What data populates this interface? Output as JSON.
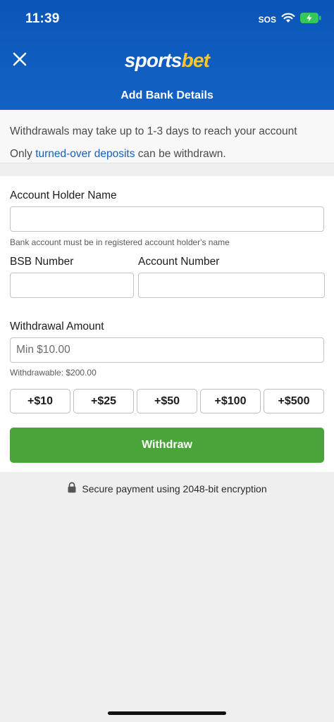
{
  "status_bar": {
    "time": "11:39",
    "sos": "SOS",
    "icons": [
      "wifi-icon",
      "battery-charging-icon"
    ],
    "battery_color": "#34c759"
  },
  "header": {
    "logo_part1": "sports",
    "logo_part2": "bet",
    "title": "Add Bank Details",
    "close_icon": "close-icon",
    "brand_color": "#0a56b8",
    "logo_accent": "#ffc62b"
  },
  "notice": {
    "line1": "Withdrawals may take up to 1-3 days to reach your account",
    "line2_prefix": "Only ",
    "line2_link": "turned-over deposits",
    "line2_suffix": " can be withdrawn."
  },
  "form": {
    "account_holder_label": "Account Holder Name",
    "account_holder_value": "",
    "account_holder_hint": "Bank account must be in registered account holder's name",
    "bsb_label": "BSB Number",
    "bsb_value": "",
    "account_number_label": "Account Number",
    "account_number_value": "",
    "amount_label": "Withdrawal Amount",
    "amount_placeholder": "Min $10.00",
    "withdrawable": "Withdrawable: $200.00",
    "quick_amounts": [
      "+$10",
      "+$25",
      "+$50",
      "+$100",
      "+$500"
    ],
    "submit_label": "Withdraw",
    "submit_color": "#4ba43a"
  },
  "footer": {
    "secure_text": "Secure payment using 2048-bit encryption",
    "lock_icon": "lock-icon"
  }
}
